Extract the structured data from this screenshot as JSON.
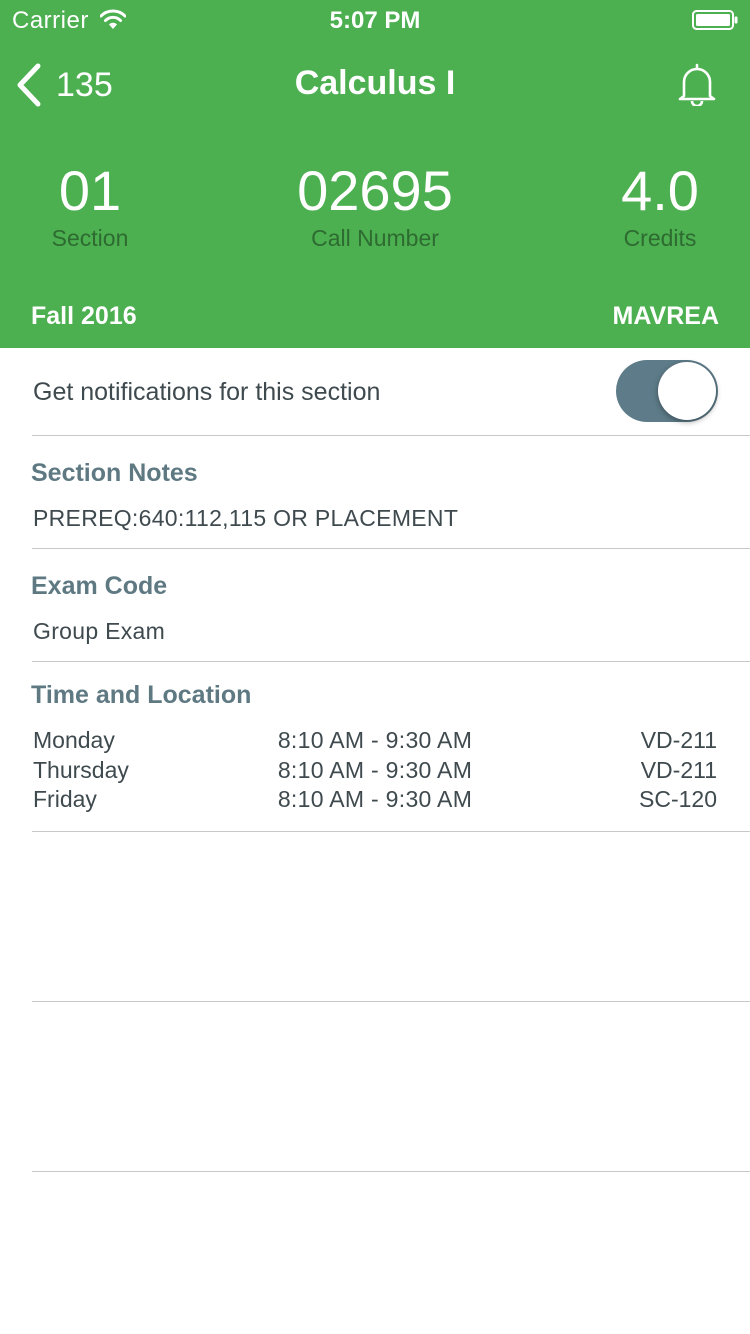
{
  "status_bar": {
    "carrier": "Carrier",
    "time": "5:07 PM"
  },
  "nav": {
    "back_count": "135",
    "title": "Calculus I"
  },
  "stats": {
    "section": {
      "value": "01",
      "label": "Section"
    },
    "call_number": {
      "value": "02695",
      "label": "Call Number"
    },
    "credits": {
      "value": "4.0",
      "label": "Credits"
    }
  },
  "term": "Fall 2016",
  "instructor": "MAVREA",
  "notifications": {
    "label": "Get notifications for this section",
    "enabled": true
  },
  "section_notes": {
    "title": "Section Notes",
    "text": "PREREQ:640:112,115 OR PLACEMENT"
  },
  "exam_code": {
    "title": "Exam Code",
    "text": "Group Exam"
  },
  "time_location": {
    "title": "Time and Location",
    "rows": [
      {
        "day": "Monday",
        "time": "8:10 AM - 9:30 AM",
        "room": "VD-211"
      },
      {
        "day": "Thursday",
        "time": "8:10 AM - 9:30 AM",
        "room": "VD-211"
      },
      {
        "day": "Friday",
        "time": "8:10 AM - 9:30 AM",
        "room": "SC-120"
      }
    ]
  },
  "colors": {
    "header": "#4caf50",
    "toggle_on": "#5d7b88",
    "section_title": "#5f7983"
  }
}
